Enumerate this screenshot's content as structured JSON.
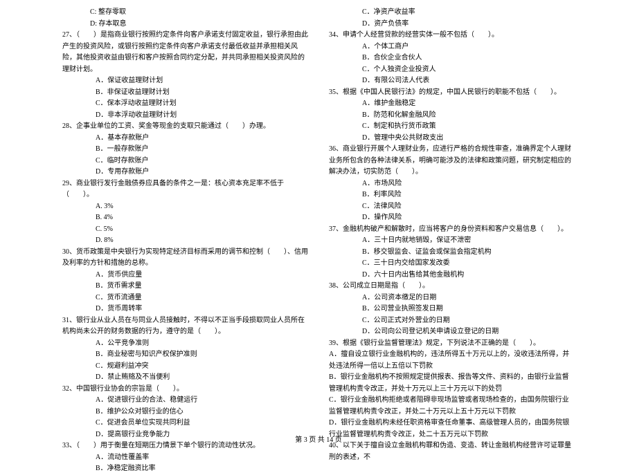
{
  "left": {
    "opt_c": "C: 整存零取",
    "opt_d": "D: 存本取息",
    "q27": "27、（　　）是指商业银行按照约定条件向客户承诺支付固定收益，银行承担由此产生的投资风险，或银行按照约定条件向客户承诺支付最低收益并承担相关风险，其他投资收益由银行和客户按照合同约定分配，并共同承担相关投资风险的理财计划。",
    "q27a": "A．保证收益理财计划",
    "q27b": "B．非保证收益理财计划",
    "q27c": "C．保本浮动收益理财计划",
    "q27d": "D．非本浮动收益理财计划",
    "q28": "28、企事业单位的工资、奖金等现金的支取只能通过（　　）办理。",
    "q28a": "A．基本存款账户",
    "q28b": "B．一般存款账户",
    "q28c": "C．临时存款账户",
    "q28d": "D．专用存款账户",
    "q29": "29、商业银行发行金融债券应具备的条件之一是：核心资本充足率不低于（　　）。",
    "q29a": "A. 3%",
    "q29b": "B. 4%",
    "q29c": "C. 5%",
    "q29d": "D. 8%",
    "q30": "30、货币政策是中央银行为实现特定经济目标而采用的调节和控制（　　）、信用及利率的方针和措施的总称。",
    "q30a": "A．货币供应量",
    "q30b": "B．货币需求量",
    "q30c": "C．货币流通量",
    "q30d": "D．货币周转率",
    "q31": "31、银行业从业人员在与同业人员接触时，不得以不正当手段损取同业人员所在机构尚未公开的财务数据的行为，遵守的是（　　）。",
    "q31a": "A．公平竞争准则",
    "q31b": "B．商业秘密与知识产权保护准则",
    "q31c": "C．规避利益冲突",
    "q31d": "D．禁止贿赂及不当便利",
    "q32": "32、中国银行业协会的宗旨是（　　）。",
    "q32a": "A．促进银行业的合法、稳健运行",
    "q32b": "B．维护公众对银行业的信心",
    "q32c": "C．促进会员单位实现共同利益",
    "q32d": "D．提高银行业竞争能力",
    "q33": "33、（　　）用于衡量在短期压力情景下单个银行的流动性状况。",
    "q33a": "A．流动性覆盖率",
    "q33b": "B．净稳定融资比率"
  },
  "right": {
    "opt_c": "C．净资产收益率",
    "opt_d": "D．资产负债率",
    "q34": "34、申请个人经营贷款的经营实体一般不包括（　　）。",
    "q34a": "A．个体工商户",
    "q34b": "B．合伙企业合伙人",
    "q34c": "C．个人独资企业投资人",
    "q34d": "D．有限公司法人代表",
    "q35": "35、根据《中国人民银行法》的规定，中国人民银行的职能不包括（　　）。",
    "q35a": "A．维护金融稳定",
    "q35b": "B．防范和化解金融风险",
    "q35c": "C．制定和执行货币政策",
    "q35d": "D．管理中央公共财政支出",
    "q36": "36、商业银行开展个人理财业务，应进行严格的合规性审查，准确界定个人理财业务所包含的各种法律关系，明确可能涉及的法律和政策问题，研究制定相应的解决办法，切实防范（　　）。",
    "q36a": "A．市场风险",
    "q36b": "B．利率风险",
    "q36c": "C．法律风险",
    "q36d": "D．操作风险",
    "q37": "37、金融机构破产和解散时，应当将客户的身份资料和客户交易信息（　　）。",
    "q37a": "A．三十日内就地销毁，保证不泄密",
    "q37b": "B．移交银监会、证监会或保监会指定机构",
    "q37c": "C．三十日内交给国家发改委",
    "q37d": "D．六十日内出售给其他金融机构",
    "q38": "38、公司成立日期是指（　　）。",
    "q38a": "A．公司资本缴足的日期",
    "q38b": "B．公司营业执照签发日期",
    "q38c": "C．公司正式对外营业的日期",
    "q38d": "D．公司向公司登记机关申请设立登记的日期",
    "q39": "39、根据《银行业监督管理法》规定，下列说法不正确的是（　　）。",
    "q39a": "A．擅自设立银行业金融机构的，违法所得五十万元以上的，没收违法所得，并处违法所得一倍以上五倍以下罚款",
    "q39b": "B．银行业金融机构不按照规定提供报表、报告等文件、资料的，由银行业监督管理机构责令改正，并处十万元以上三十万元以下的处罚",
    "q39c": "C．银行业金融机构拒绝或者阻碍非现场监管或者现场检查的，由国务院银行业监督管理机构责令改正，并处二十万元以上五十万元以下罚款",
    "q39d": "D．银行业金融机构未经任职资格审查任命董事、高级管理人员的，由国务院银行业监督管理机构责令改正，处二十五万元以下罚款",
    "q40": "40、以下关于擅自设立金融机构罪和伪造、变造、转让金融机构经营许可证罪量刑的表述，不"
  },
  "footer": "第 3 页 共 14 页"
}
